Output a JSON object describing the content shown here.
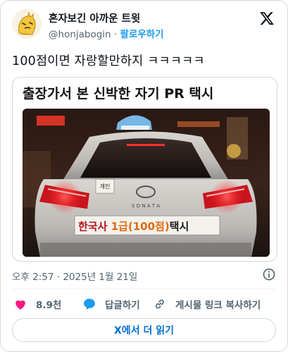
{
  "account": {
    "display_name": "혼자보긴 아까운 트윗",
    "handle": "@honjabogin",
    "separator": "·",
    "follow_label": "팔로우하기"
  },
  "tweet": {
    "text": "100점이면 자랑할만하지 ㅋㅋㅋㅋㅋ",
    "media_caption": "출장가서 본 신박한 자기 PR 택시",
    "timestamp": "오후 2:57 · 2025년 1월 21일"
  },
  "photo": {
    "sign_prefix": "한국사 ",
    "sign_grade": "1급",
    "sign_score": "(100점)",
    "sign_suffix": "택시",
    "small_sign": "개인",
    "trunk_text": "S O N A T A"
  },
  "actions": {
    "like_count": "8.9천",
    "reply_label": "답글하기",
    "copy_link_label": "게시물 링크 복사하기"
  },
  "footer": {
    "read_more_label": "X에서 더 읽기"
  },
  "colors": {
    "like_red": "#f91880",
    "reply_blue": "#1d9bf0",
    "link_blue": "#006fd6",
    "muted": "#536471"
  }
}
